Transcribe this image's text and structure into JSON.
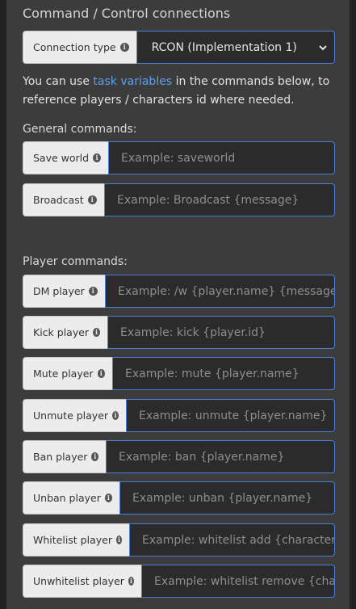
{
  "section_title": "Command / Control connections",
  "connection": {
    "label": "Connection type",
    "selected": "RCON (Implementation 1)"
  },
  "info": {
    "before": "You can use ",
    "link": "task variables",
    "after": " in the commands below, to reference players / characters id where needed."
  },
  "general": {
    "heading": "General commands:",
    "items": [
      {
        "label": "Save world",
        "placeholder": "Example: saveworld"
      },
      {
        "label": "Broadcast",
        "placeholder": "Example: Broadcast {message}"
      }
    ]
  },
  "player": {
    "heading": "Player commands:",
    "items": [
      {
        "label": "DM player",
        "placeholder": "Example: /w {player.name} {message}"
      },
      {
        "label": "Kick player",
        "placeholder": "Example: kick {player.id}"
      },
      {
        "label": "Mute player",
        "placeholder": "Example: mute {player.name}"
      },
      {
        "label": "Unmute player",
        "placeholder": "Example: unmute {player.name}"
      },
      {
        "label": "Ban player",
        "placeholder": "Example: ban {player.name}"
      },
      {
        "label": "Unban player",
        "placeholder": "Example: unban {player.name}"
      },
      {
        "label": "Whitelist player",
        "placeholder": "Example: whitelist add {character.id}"
      },
      {
        "label": "Unwhitelist player",
        "placeholder": "Example: whitelist remove {character.id}"
      }
    ]
  },
  "icons": {
    "info": "info-icon",
    "dropdown": "chevron-down-icon"
  },
  "colors": {
    "accent": "#4a7fd6",
    "link": "#5aa0f2",
    "panel": "#3c3c3c"
  }
}
